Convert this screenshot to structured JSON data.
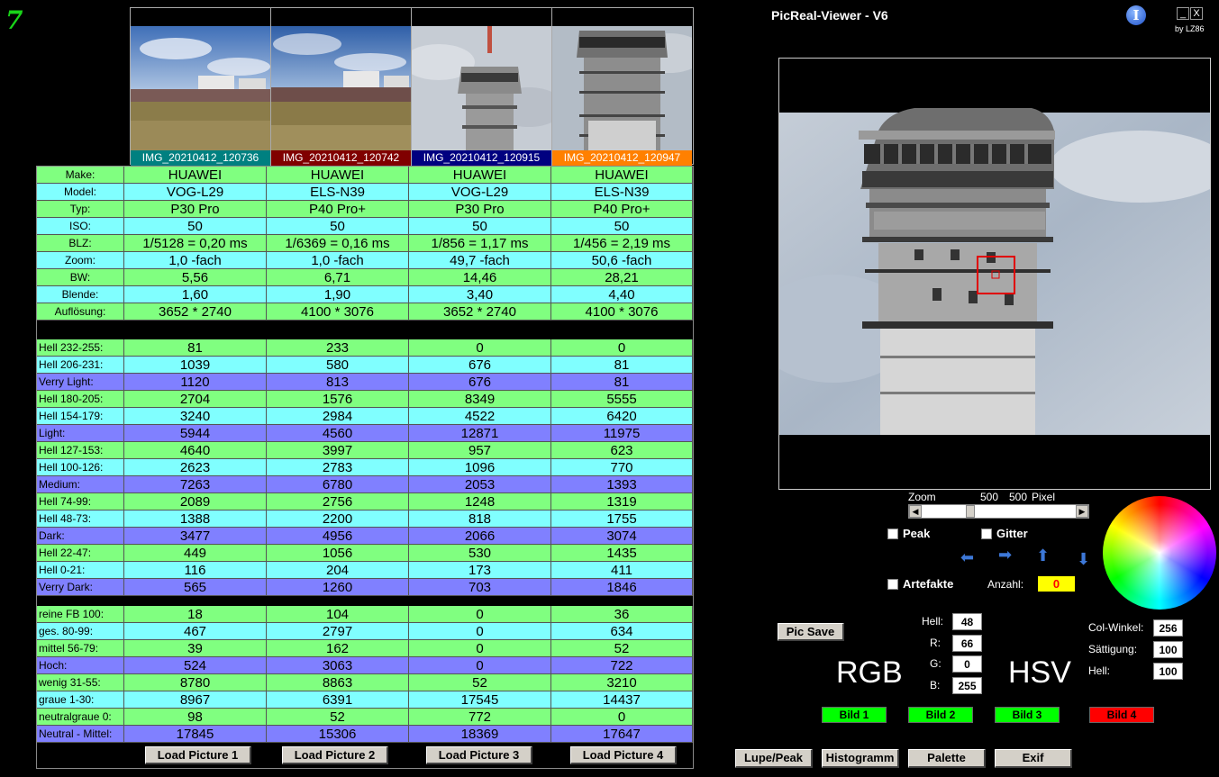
{
  "app": {
    "logo": "7",
    "title": "PicReal-Viewer - V6",
    "byline": "by LZ86",
    "info_icon": "info-icon",
    "minimize": "_",
    "close": "X"
  },
  "thumbnails": [
    {
      "name": "IMG_20210412_120736",
      "caption_color": "#008080"
    },
    {
      "name": "IMG_20210412_120742",
      "caption_color": "#800000"
    },
    {
      "name": "IMG_20210412_120915",
      "caption_color": "#000080"
    },
    {
      "name": "IMG_20210412_120947",
      "caption_color": "#ff8000"
    }
  ],
  "exif_rows": [
    {
      "label": "Make:",
      "values": [
        "HUAWEI",
        "HUAWEI",
        "HUAWEI",
        "HUAWEI"
      ],
      "color": "g"
    },
    {
      "label": "Model:",
      "values": [
        "VOG-L29",
        "ELS-N39",
        "VOG-L29",
        "ELS-N39"
      ],
      "color": "c"
    },
    {
      "label": "Typ:",
      "values": [
        "P30 Pro",
        "P40 Pro+",
        "P30 Pro",
        "P40 Pro+"
      ],
      "color": "g"
    },
    {
      "label": "ISO:",
      "values": [
        "50",
        "50",
        "50",
        "50"
      ],
      "color": "c"
    },
    {
      "label": "BLZ:",
      "values": [
        "1/5128 = 0,20 ms",
        "1/6369 = 0,16 ms",
        "1/856 = 1,17 ms",
        "1/456 = 2,19 ms"
      ],
      "color": "g"
    },
    {
      "label": "Zoom:",
      "values": [
        "1,0 -fach",
        "1,0 -fach",
        "49,7 -fach",
        "50,6 -fach"
      ],
      "color": "c"
    },
    {
      "label": "BW:",
      "values": [
        "5,56",
        "6,71",
        "14,46",
        "28,21"
      ],
      "color": "g"
    },
    {
      "label": "Blende:",
      "values": [
        "1,60",
        "1,90",
        "3,40",
        "4,40"
      ],
      "color": "c"
    },
    {
      "label": "Auflösung:",
      "values": [
        "3652 * 2740",
        "4100 * 3076",
        "3652 * 2740",
        "4100 * 3076"
      ],
      "color": "g"
    }
  ],
  "bright_rows": [
    {
      "label": "Hell 232-255:",
      "values": [
        "81",
        "233",
        "0",
        "0"
      ],
      "color": "g"
    },
    {
      "label": "Hell 206-231:",
      "values": [
        "1039",
        "580",
        "676",
        "81"
      ],
      "color": "c"
    },
    {
      "label": "Verry Light:",
      "values": [
        "1120",
        "813",
        "676",
        "81"
      ],
      "color": "p"
    },
    {
      "label": "Hell 180-205:",
      "values": [
        "2704",
        "1576",
        "8349",
        "5555"
      ],
      "color": "g"
    },
    {
      "label": "Hell 154-179:",
      "values": [
        "3240",
        "2984",
        "4522",
        "6420"
      ],
      "color": "c"
    },
    {
      "label": "Light:",
      "values": [
        "5944",
        "4560",
        "12871",
        "11975"
      ],
      "color": "p"
    },
    {
      "label": "Hell 127-153:",
      "values": [
        "4640",
        "3997",
        "957",
        "623"
      ],
      "color": "g"
    },
    {
      "label": "Hell 100-126:",
      "values": [
        "2623",
        "2783",
        "1096",
        "770"
      ],
      "color": "c"
    },
    {
      "label": "Medium:",
      "values": [
        "7263",
        "6780",
        "2053",
        "1393"
      ],
      "color": "p"
    },
    {
      "label": "Hell 74-99:",
      "values": [
        "2089",
        "2756",
        "1248",
        "1319"
      ],
      "color": "g"
    },
    {
      "label": "Hell 48-73:",
      "values": [
        "1388",
        "2200",
        "818",
        "1755"
      ],
      "color": "c"
    },
    {
      "label": "Dark:",
      "values": [
        "3477",
        "4956",
        "2066",
        "3074"
      ],
      "color": "p"
    },
    {
      "label": "Hell 22-47:",
      "values": [
        "449",
        "1056",
        "530",
        "1435"
      ],
      "color": "g"
    },
    {
      "label": "Hell 0-21:",
      "values": [
        "116",
        "204",
        "173",
        "411"
      ],
      "color": "c"
    },
    {
      "label": "Verry Dark:",
      "values": [
        "565",
        "1260",
        "703",
        "1846"
      ],
      "color": "p"
    }
  ],
  "color_rows": [
    {
      "label": "reine FB 100:",
      "values": [
        "18",
        "104",
        "0",
        "36"
      ],
      "color": "g"
    },
    {
      "label": "ges. 80-99:",
      "values": [
        "467",
        "2797",
        "0",
        "634"
      ],
      "color": "c"
    },
    {
      "label": "mittel 56-79:",
      "values": [
        "39",
        "162",
        "0",
        "52"
      ],
      "color": "g"
    },
    {
      "label": "Hoch:",
      "values": [
        "524",
        "3063",
        "0",
        "722"
      ],
      "color": "p"
    },
    {
      "label": "wenig 31-55:",
      "values": [
        "8780",
        "8863",
        "52",
        "3210"
      ],
      "color": "g"
    },
    {
      "label": "graue  1-30:",
      "values": [
        "8967",
        "6391",
        "17545",
        "14437"
      ],
      "color": "c"
    },
    {
      "label": "neutralgraue 0:",
      "values": [
        "98",
        "52",
        "772",
        "0"
      ],
      "color": "g"
    },
    {
      "label": "Neutral - Mittel:",
      "values": [
        "17845",
        "15306",
        "18369",
        "17647"
      ],
      "color": "p"
    }
  ],
  "load_buttons": [
    "Load Picture 1",
    "Load Picture 2",
    "Load Picture 3",
    "Load Picture 4"
  ],
  "controls": {
    "zoom_label": "Zoom",
    "zoom_w": "500",
    "zoom_h": "500",
    "pixel_label": "Pixel",
    "zoom_slider_fraction": 0.3,
    "peak_label": "Peak",
    "gitter_label": "Gitter",
    "artefakte_label": "Artefakte",
    "anzahl_label": "Anzahl:",
    "anzahl_value": "0",
    "pic_save": "Pic Save",
    "rgb_label": "RGB",
    "hsv_label": "HSV",
    "hell_label": "Hell:",
    "hell_value": "48",
    "r_label": "R:",
    "r_value": "66",
    "g_label": "G:",
    "g_value": "0",
    "b_label": "B:",
    "b_value": "255",
    "colwinkel_label": "Col-Winkel:",
    "colwinkel_value": "256",
    "saettigung_label": "Sättigung:",
    "saettigung_value": "100",
    "hsv_hell_label": "Hell:",
    "hsv_hell_value": "100",
    "arrows": [
      "arrow-left-icon",
      "arrow-right-icon",
      "arrow-up-icon",
      "arrow-down-icon"
    ]
  },
  "bild_buttons": [
    {
      "label": "Bild 1",
      "color": "#00ff00"
    },
    {
      "label": "Bild 2",
      "color": "#00ff00"
    },
    {
      "label": "Bild 3",
      "color": "#00ff00"
    },
    {
      "label": "Bild 4",
      "color": "#ff0000"
    }
  ],
  "bottom_buttons": [
    "Lupe/Peak",
    "Histogramm",
    "Palette",
    "Exif"
  ]
}
